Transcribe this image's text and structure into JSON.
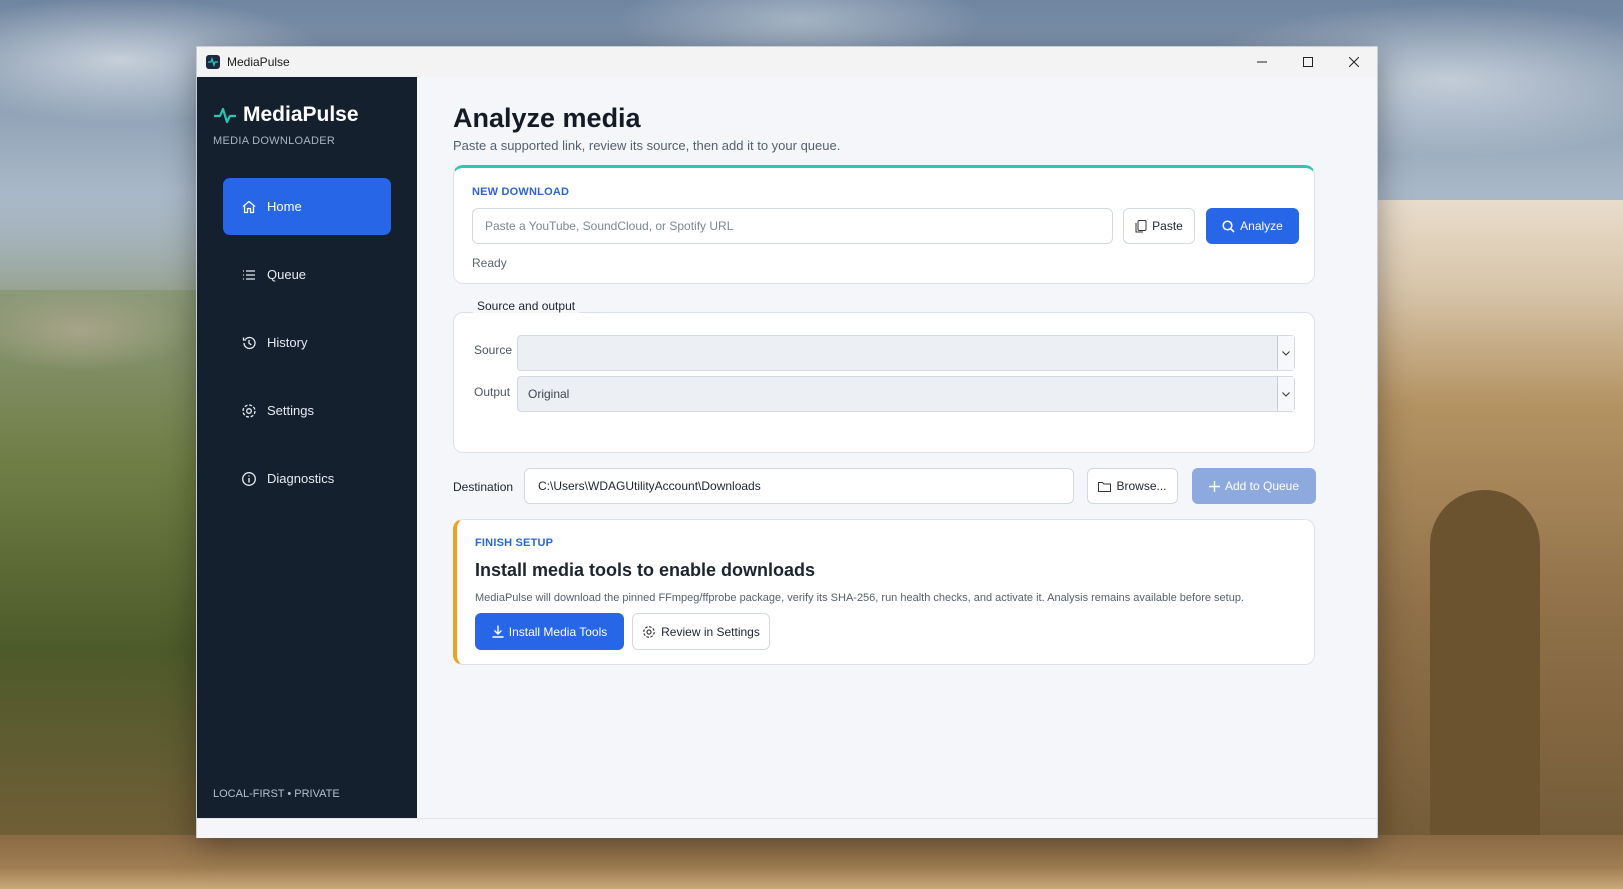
{
  "window": {
    "title": "MediaPulse"
  },
  "sidebar": {
    "brand": "MediaPulse",
    "subtitle": "MEDIA DOWNLOADER",
    "items": [
      {
        "label": "Home",
        "icon": "home-icon",
        "active": true
      },
      {
        "label": "Queue",
        "icon": "list-icon"
      },
      {
        "label": "History",
        "icon": "history-icon"
      },
      {
        "label": "Settings",
        "icon": "gear-icon"
      },
      {
        "label": "Diagnostics",
        "icon": "info-icon"
      }
    ],
    "footer": "LOCAL-FIRST • PRIVATE"
  },
  "main": {
    "title": "Analyze media",
    "subtitle": "Paste a supported link, review its source, then add it to your queue.",
    "new_download": {
      "label": "NEW DOWNLOAD",
      "url_placeholder": "Paste a YouTube, SoundCloud, or Spotify URL",
      "url_value": "",
      "paste_label": "Paste",
      "analyze_label": "Analyze",
      "status": "Ready"
    },
    "source_output": {
      "legend": "Source and output",
      "source_label": "Source",
      "source_value": "",
      "output_label": "Output",
      "output_value": "Original"
    },
    "destination": {
      "label": "Destination",
      "value": "C:\\Users\\WDAGUtilityAccount\\Downloads",
      "browse_label": "Browse...",
      "add_label": "Add to Queue"
    },
    "setup": {
      "label": "FINISH SETUP",
      "title": "Install media tools to enable downloads",
      "description": "MediaPulse will download the pinned FFmpeg/ffprobe package, verify its SHA-256, run health checks, and activate it. Analysis remains available before setup.",
      "install_label": "Install Media Tools",
      "review_label": "Review in Settings"
    }
  },
  "colors": {
    "accent": "#2866e8",
    "sidebar_bg": "#15202f",
    "teal": "#2cc7b2",
    "warning": "#f0a122"
  }
}
